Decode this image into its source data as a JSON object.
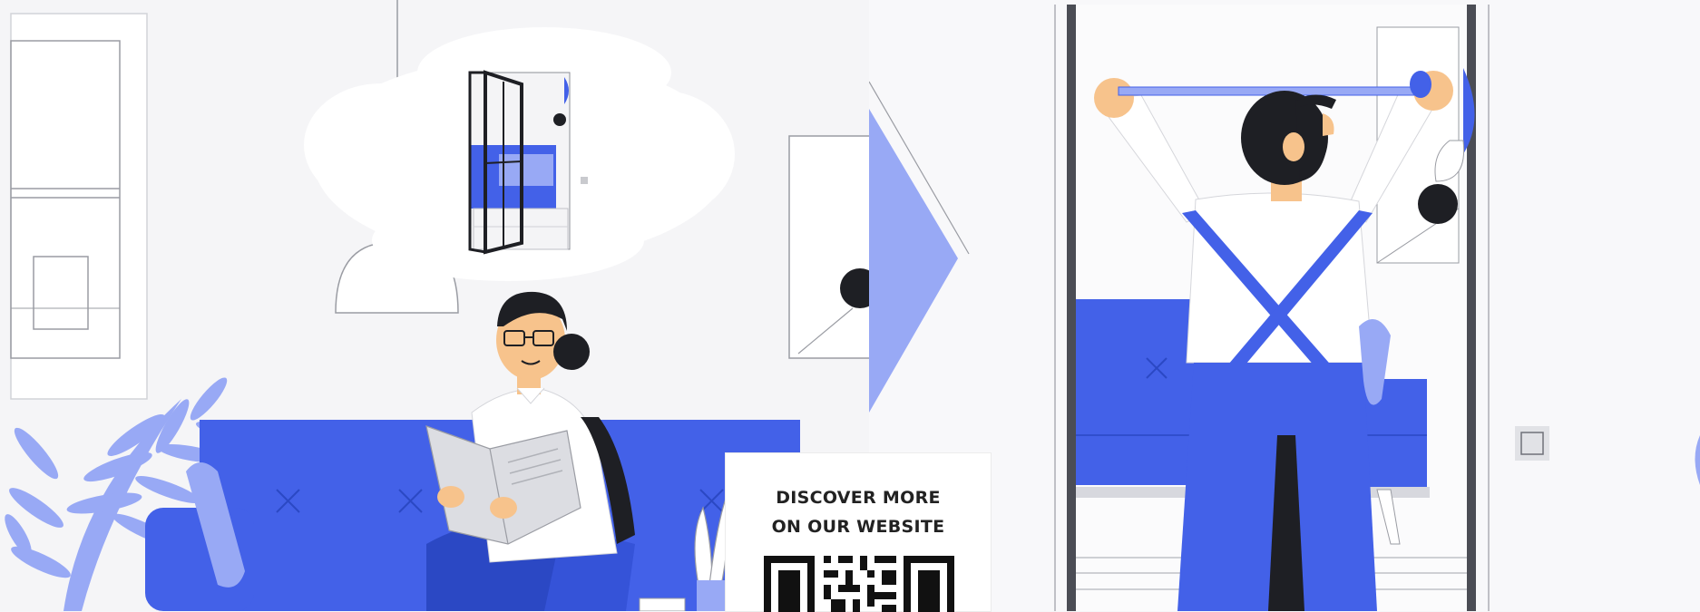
{
  "promo": {
    "line1": "DISCOVER MORE",
    "line2": "ON OUR WEBSITE"
  },
  "colors": {
    "accent_blue": "#4361e8",
    "light_blue": "#98a9f5",
    "dark": "#1e1f24",
    "skin": "#f7c38c",
    "background": "#f5f5f7"
  },
  "icons": {
    "qr": "qr-code-icon",
    "thought": "thought-bubble-icon"
  }
}
